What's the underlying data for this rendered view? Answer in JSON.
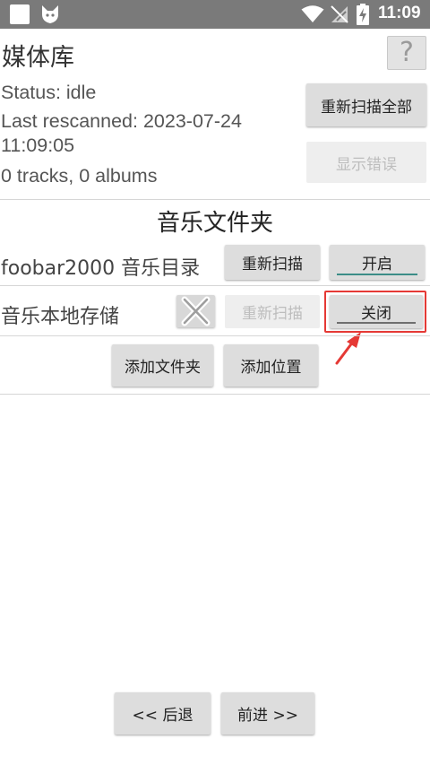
{
  "status_bar": {
    "time": "11:09",
    "icons": [
      "app-square-icon",
      "fox-icon",
      "wifi-icon",
      "no-signal-icon",
      "battery-charging-icon"
    ]
  },
  "header": {
    "title": "媒体库",
    "help_label": "?"
  },
  "status": {
    "status_line": "Status: idle",
    "rescanned_line1": "Last rescanned: 2023-07-24",
    "rescanned_line2": "11:09:05",
    "counts_line": "0 tracks, 0 albums",
    "rescan_all_label": "重新扫描全部",
    "show_errors_label": "显示错误"
  },
  "music_folders": {
    "section_title": "音乐文件夹",
    "rows": [
      {
        "label": "foobar2000 音乐目录",
        "rescan_label": "重新扫描",
        "toggle_label": "开启",
        "toggle_state": "on"
      },
      {
        "label": "音乐本地存储",
        "rescan_label": "重新扫描",
        "toggle_label": "关闭",
        "toggle_state": "off"
      }
    ],
    "add_folder_label": "添加文件夹",
    "add_location_label": "添加位置"
  },
  "navigation": {
    "back_label": "<< 后退",
    "forward_label": "前进 >>"
  },
  "colors": {
    "status_bar": "#7a7a7a",
    "toggle_on_underline": "#3c8d87",
    "annotation_red": "#e53935"
  }
}
